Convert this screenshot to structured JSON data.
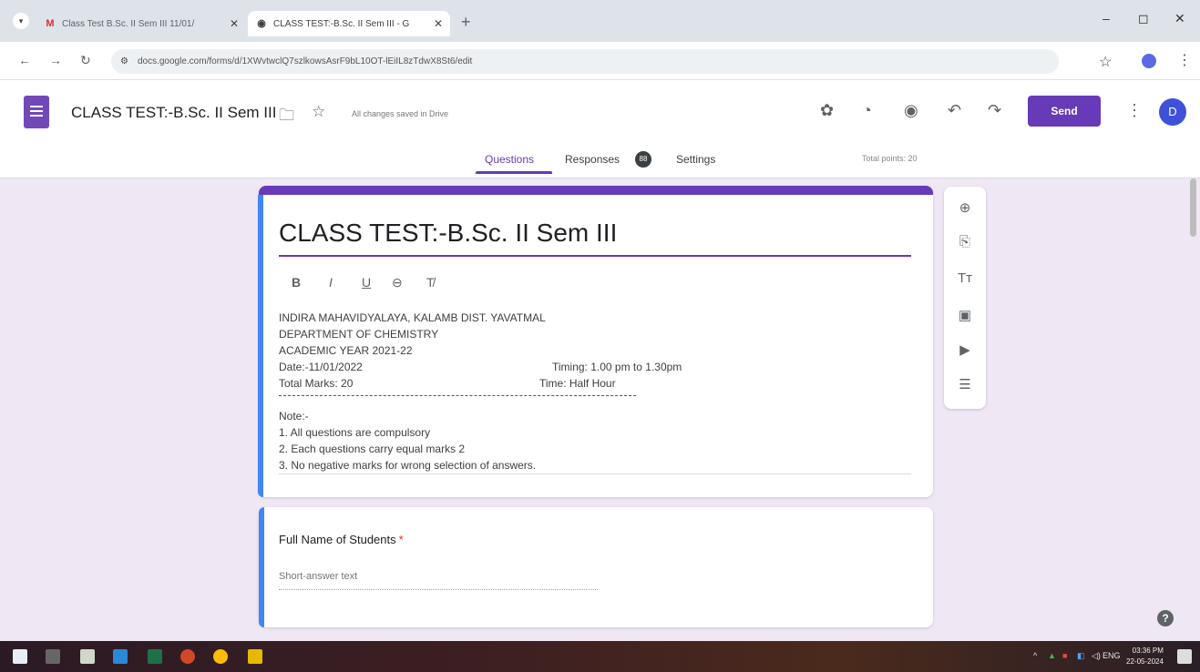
{
  "browser": {
    "tabs": [
      {
        "title": "Class Test B.Sc. II Sem III 11/01/",
        "favicon": "M"
      },
      {
        "title": "CLASS TEST:-B.Sc. II Sem III - G",
        "favicon": "chrome-icon"
      }
    ],
    "url": "docs.google.com/forms/d/1XWvtwclQ7szlkowsAsrF9bL10OT-lEiIL8zTdwX8St6/edit"
  },
  "forms_header": {
    "doc_title": "CLASS TEST:-B.Sc. II Sem III",
    "saved_status": "All changes saved in Drive",
    "send_label": "Send",
    "avatar_letter": "D",
    "tabs": [
      {
        "label": "Questions",
        "active": true
      },
      {
        "label": "Responses",
        "badge": "88"
      },
      {
        "label": "Settings"
      }
    ],
    "total_points": "Total points: 20"
  },
  "title_card": {
    "title": "CLASS TEST:-B.Sc. II Sem III",
    "format_buttons": [
      "B",
      "I",
      "U"
    ],
    "description": {
      "line1": "INDIRA MAHAVIDYALAYA, KALAMB DIST. YAVATMAL",
      "line2": "DEPARTMENT OF CHEMISTRY",
      "line3": "ACADEMIC YEAR 2021-22",
      "date": "Date:-11/01/2022",
      "timing": "Timing: 1.00 pm to 1.30pm",
      "total_marks": "Total Marks: 20",
      "time": "Time: Half Hour",
      "note": "Note:-",
      "notes": [
        "1.   All questions are compulsory",
        "2.   Each questions carry equal marks 2",
        "3.   No negative marks for wrong selection of answers."
      ]
    }
  },
  "question_card": {
    "label": "Full Name of Students",
    "required_mark": "*",
    "placeholder": "Short-answer text"
  },
  "tool_panel": {
    "items": [
      "add-question",
      "import-questions",
      "add-title-description",
      "add-image",
      "add-video",
      "add-section"
    ],
    "title_glyph": "Tт"
  },
  "taskbar": {
    "lang": "ENG",
    "time": "03:36 PM",
    "date": "22-05-2024"
  },
  "colors": {
    "accent": "#673ab7",
    "card_border_active": "#4285f4",
    "page_bg": "#efe8f4"
  }
}
